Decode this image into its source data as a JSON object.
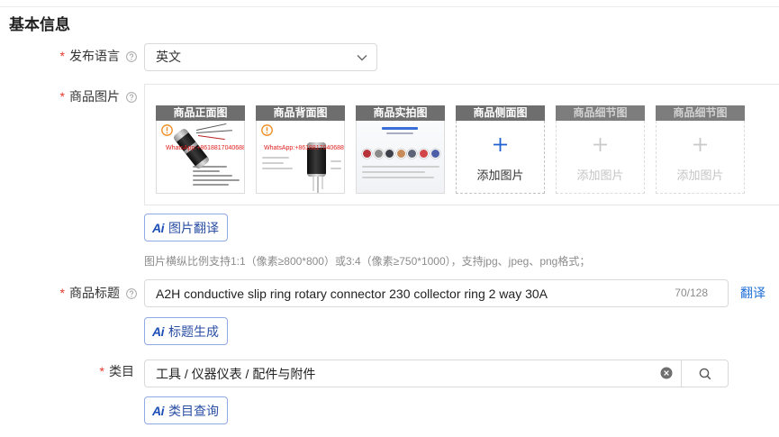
{
  "section_title": "基本信息",
  "required_mark": "*",
  "language": {
    "label": "发布语言",
    "value": "英文",
    "help_icon": "question-circle-icon",
    "dropdown_icon": "chevron-down-icon"
  },
  "images": {
    "label": "商品图片",
    "help_icon": "question-circle-icon",
    "slots": [
      {
        "title": "商品正面图",
        "has_image": true,
        "watermark": "WhatsApp:+8618817040688",
        "badge_icon": "warning-circle-icon"
      },
      {
        "title": "商品背面图",
        "has_image": true,
        "watermark": "WhatsApp:+8618817040688",
        "badge_icon": "warning-circle-icon"
      },
      {
        "title": "商品实拍图",
        "has_image": true
      },
      {
        "title": "商品侧面图",
        "has_image": false,
        "disabled": false,
        "add_label": "添加图片",
        "add_icon": "plus-icon"
      },
      {
        "title": "商品细节图",
        "has_image": false,
        "disabled": true,
        "add_label": "添加图片",
        "add_icon": "plus-icon"
      },
      {
        "title": "商品细节图",
        "has_image": false,
        "disabled": true,
        "add_label": "添加图片",
        "add_icon": "plus-icon"
      }
    ],
    "translate_button": {
      "ai_mark": "Ai",
      "label": "图片翻译"
    },
    "hint": "图片横纵比例支持1:1（像素≥800*800）或3:4（像素≥750*1000），支持jpg、jpeg、png格式；"
  },
  "product_title": {
    "label": "商品标题",
    "help_icon": "question-circle-icon",
    "value": "A2H conductive slip ring rotary connector 230 collector ring 2 way 30A",
    "counter": "70/128",
    "translate_link": "翻译",
    "generate_button": {
      "ai_mark": "Ai",
      "label": "标题生成"
    }
  },
  "category": {
    "label": "类目",
    "value": "工具 / 仪器仪表 / 配件与附件",
    "clear_icon": "clear-circle-icon",
    "search_icon": "search-icon",
    "query_button": {
      "ai_mark": "Ai",
      "label": "类目查询"
    }
  },
  "colors": {
    "required": "#e5392c",
    "accent": "#1f5fd1",
    "link": "#1f6fd6",
    "slot_header": "#6e6e6e",
    "watermark": "#e02020",
    "badge": "#f08a1c",
    "ai": "#1d4fb8"
  }
}
